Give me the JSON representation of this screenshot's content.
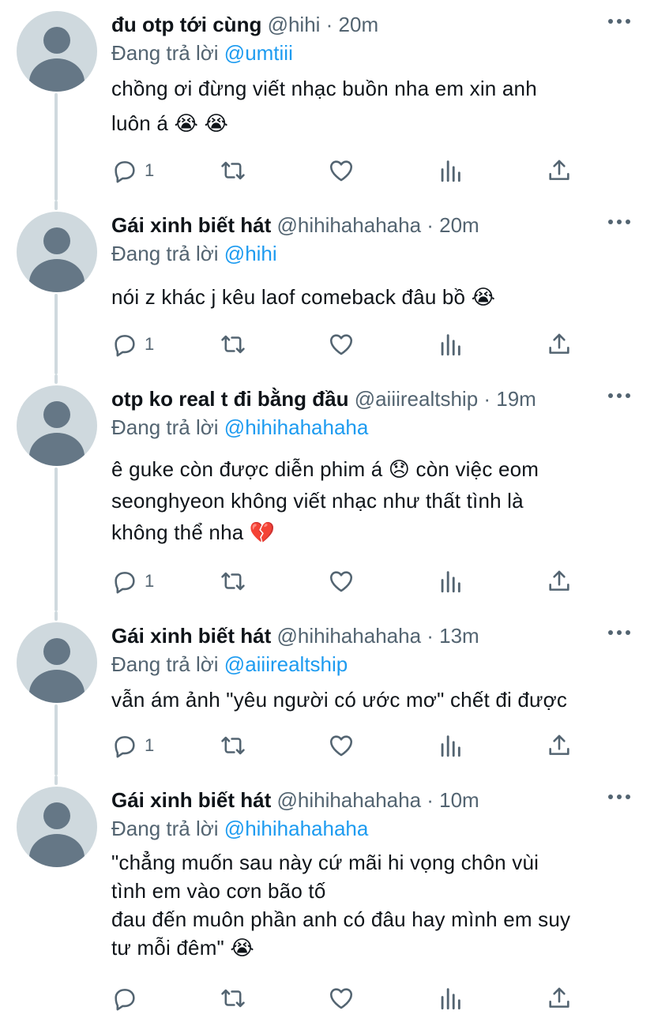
{
  "colors": {
    "name": "#0f1419",
    "secondary": "#536471",
    "link": "#1d9bf0",
    "thread_line": "#cfd9de"
  },
  "tweets": [
    {
      "name": "đu otp tới cùng",
      "meta": "@hihi · 20m",
      "replying_label": "Đang trả lời",
      "replying_to": "@umtiii",
      "text": "chồng ơi đừng viết nhạc buồn nha em xin anh\nluôn á 😭 😭",
      "reply_count": "1"
    },
    {
      "name": "Gái xinh biết hát",
      "meta": "@hihihahahaha · 20m",
      "replying_label": "Đang trả lời",
      "replying_to": "@hihi",
      "text": "nói z khác j kêu laof comeback đâu bồ 😭",
      "reply_count": "1"
    },
    {
      "name": "otp ko real t đi bằng đầu",
      "meta": "@aiiirealtship · 19m",
      "replying_label": "Đang trả lời",
      "replying_to": "@hihihahahaha",
      "text": "ê guke còn được diễn phim á 😞  còn việc eom\nseonghyeon không viết nhạc như thất tình là\nkhông thể nha 💔",
      "reply_count": "1"
    },
    {
      "name": "Gái xinh biết hát",
      "meta": "@hihihahahaha · 13m",
      "replying_label": "Đang trả lời",
      "replying_to": "@aiiirealtship",
      "text": "vẫn ám ảnh \"yêu người có ước mơ\" chết đi được",
      "reply_count": "1"
    },
    {
      "name": "Gái xinh biết hát",
      "meta": "@hihihahahaha · 10m",
      "replying_label": "Đang trả lời",
      "replying_to": "@hihihahahaha",
      "text": "\"chẳng muốn sau này cứ mãi hi vọng chôn vùi\ntình em vào cơn bão tố\nđau đến muôn phần anh có đâu hay mình em suy\ntư mỗi đêm\" 😭",
      "reply_count": ""
    }
  ]
}
